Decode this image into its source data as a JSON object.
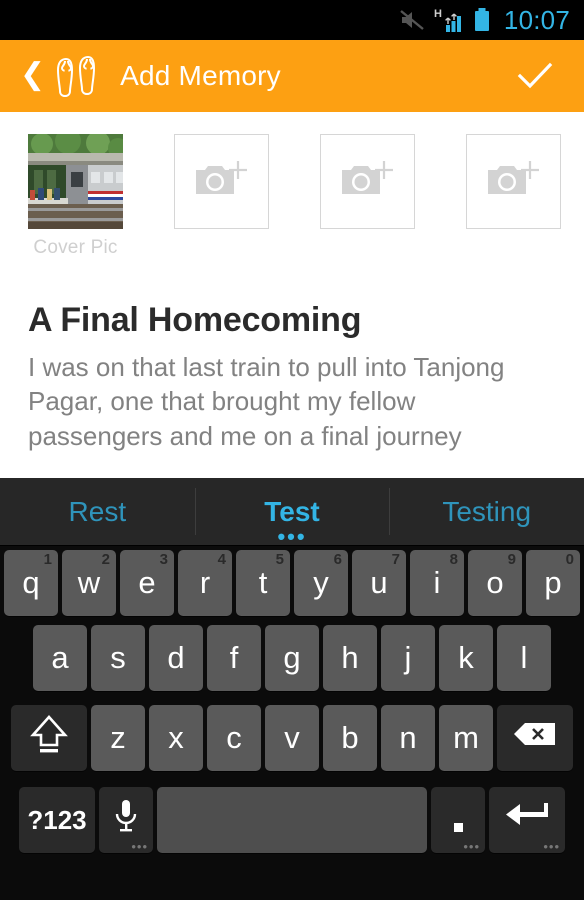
{
  "status_bar": {
    "time": "10:07",
    "time_color": "#33b5e5",
    "icons": [
      "silent-mode-icon",
      "signal-hspa-icon",
      "battery-icon"
    ],
    "network_type": "H"
  },
  "action_bar": {
    "back_label": "❮",
    "logo_icon": "flip-flops-icon",
    "title": "Add Memory",
    "confirm_icon": "check-icon",
    "background_color": "#fda012",
    "text_color": "#ffffff"
  },
  "photos": {
    "cover_label": "Cover Pic",
    "cover_alt": "train-at-platform-photo",
    "placeholders": [
      {
        "icon": "camera-plus-icon"
      },
      {
        "icon": "camera-plus-icon"
      },
      {
        "icon": "camera-plus-icon"
      }
    ]
  },
  "memory": {
    "title": "A Final Homecoming",
    "body": "I was on that last train to pull into Tanjong Pagar, one that brought my fellow passengers and me on a final journey",
    "title_color": "#2b2b2b",
    "body_color": "#828282"
  },
  "keyboard": {
    "suggestions": [
      {
        "text": "Rest",
        "active": false
      },
      {
        "text": "Test",
        "active": true,
        "dots": "•••"
      },
      {
        "text": "Testing",
        "active": false
      }
    ],
    "accent_color": "#33b5e5",
    "row1": [
      {
        "key": "q",
        "num": "1"
      },
      {
        "key": "w",
        "num": "2"
      },
      {
        "key": "e",
        "num": "3"
      },
      {
        "key": "r",
        "num": "4"
      },
      {
        "key": "t",
        "num": "5"
      },
      {
        "key": "y",
        "num": "6"
      },
      {
        "key": "u",
        "num": "7"
      },
      {
        "key": "i",
        "num": "8"
      },
      {
        "key": "o",
        "num": "9"
      },
      {
        "key": "p",
        "num": "0"
      }
    ],
    "row2": [
      {
        "key": "a"
      },
      {
        "key": "s"
      },
      {
        "key": "d"
      },
      {
        "key": "f"
      },
      {
        "key": "g"
      },
      {
        "key": "h"
      },
      {
        "key": "j"
      },
      {
        "key": "k"
      },
      {
        "key": "l"
      }
    ],
    "row3": [
      {
        "key": "z"
      },
      {
        "key": "x"
      },
      {
        "key": "c"
      },
      {
        "key": "v"
      },
      {
        "key": "b"
      },
      {
        "key": "n"
      },
      {
        "key": "m"
      }
    ],
    "shift_icon": "shift-key-icon",
    "delete_icon": "backspace-key-icon",
    "symbols_label": "?123",
    "mic_icon": "microphone-key-icon",
    "space_label": "",
    "period_label": ".",
    "enter_icon": "enter-key-icon"
  }
}
